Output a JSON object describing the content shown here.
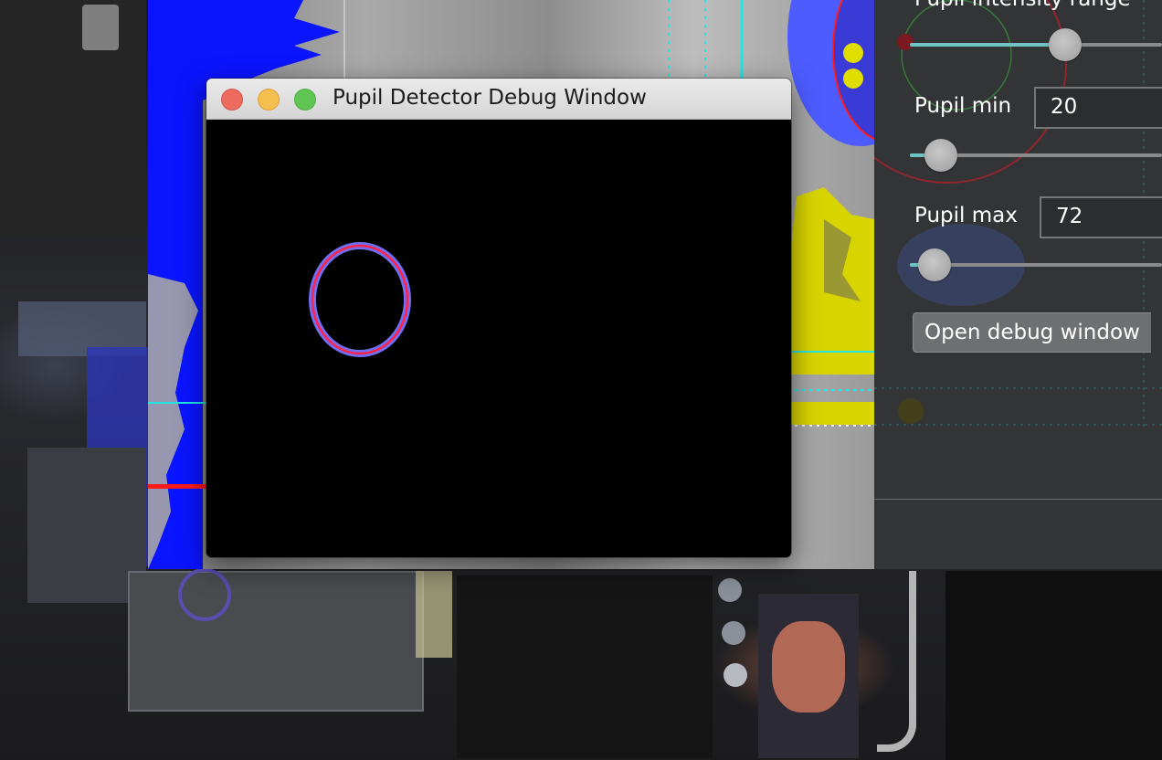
{
  "debug_window": {
    "title": "Pupil Detector Debug Window",
    "buttons": [
      "close",
      "minimize",
      "zoom"
    ]
  },
  "settings_panel": {
    "intensity_range_label": "Pupil intensity range",
    "pupil_min_label": "Pupil min",
    "pupil_min_value": "20",
    "pupil_max_label": "Pupil max",
    "pupil_max_value": "72",
    "open_debug_button_label": "Open debug window"
  },
  "colors": {
    "pupil_ellipse_outer": "#6f6ff5",
    "pupil_ellipse_inner": "#ff2244",
    "histogram_blue": "#0a14ff",
    "slider_fill": "#6fc3c3",
    "sidebar_bg": "#333436",
    "detection_yellow": "#d8d400",
    "guide_cyan": "#22e6e6"
  },
  "icons": {
    "close": "close-button-icon",
    "minimize": "minimize-button-icon",
    "zoom": "zoom-button-icon"
  }
}
